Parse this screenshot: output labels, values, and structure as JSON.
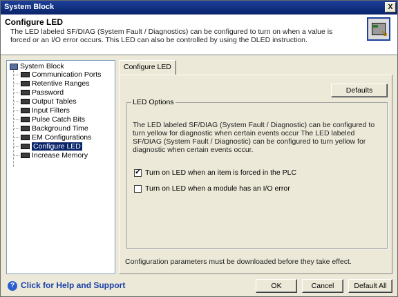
{
  "window": {
    "title": "System Block",
    "close_label": "X"
  },
  "header": {
    "title": "Configure LED",
    "description": "The LED labeled SF/DIAG (System Fault / Diagnostics) can be configured to turn on when a value is forced or an I/O error occurs.  This LED can also be controlled by using the DLED instruction."
  },
  "tree": {
    "root_label": "System Block",
    "items": [
      "Communication Ports",
      "Retentive Ranges",
      "Password",
      "Output Tables",
      "Input Filters",
      "Pulse Catch Bits",
      "Background Time",
      "EM Configurations",
      "Configure LED",
      "Increase Memory"
    ],
    "selected": "Configure LED"
  },
  "tabs": [
    {
      "label": "Configure LED"
    }
  ],
  "panel": {
    "defaults_label": "Defaults",
    "group_label": "LED Options",
    "group_text": "The LED labeled SF/DIAG (System Fault / Diagnostic) can be configured to turn yellow for diagnostic when certain events occur The LED labeled SF/DIAG (System Fault / Diagnostic) can be configured to turn yellow for diagnostic when certain events occur.",
    "checkbox1_label": "Turn on LED when an item is forced in the PLC",
    "checkbox1_checked": true,
    "checkbox2_label": "Turn on LED when a module has an I/O error",
    "checkbox2_checked": false,
    "note": "Configuration parameters must be downloaded before they take effect."
  },
  "footer": {
    "help_label": "Click for Help and Support",
    "ok_label": "OK",
    "cancel_label": "Cancel",
    "default_all_label": "Default All"
  }
}
